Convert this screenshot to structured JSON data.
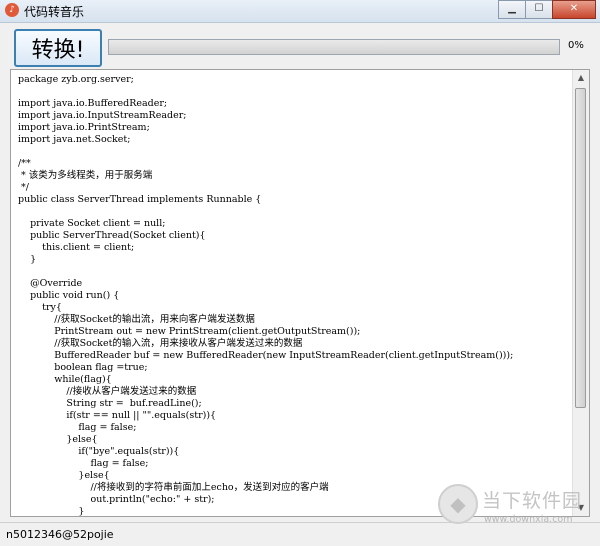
{
  "window": {
    "title": "代码转音乐"
  },
  "toolbar": {
    "convert_label": "转换!",
    "progress_fraction": 0,
    "progress_text": "0%"
  },
  "editor": {
    "code": "package zyb.org.server;\n\nimport java.io.BufferedReader;\nimport java.io.InputStreamReader;\nimport java.io.PrintStream;\nimport java.net.Socket;\n\n/**\n * 该类为多线程类，用于服务端\n */\npublic class ServerThread implements Runnable {\n\n    private Socket client = null;\n    public ServerThread(Socket client){\n        this.client = client;\n    }\n\n    @Override\n    public void run() {\n        try{\n            //获取Socket的输出流，用来向客户端发送数据\n            PrintStream out = new PrintStream(client.getOutputStream());\n            //获取Socket的输入流，用来接收从客户端发送过来的数据\n            BufferedReader buf = new BufferedReader(new InputStreamReader(client.getInputStream()));\n            boolean flag =true;\n            while(flag){\n                //接收从客户端发送过来的数据\n                String str =  buf.readLine();\n                if(str == null || \"\".equals(str)){\n                    flag = false;\n                }else{\n                    if(\"bye\".equals(str)){\n                        flag = false;\n                    }else{\n                        //将接收到的字符串前面加上echo，发送到对应的客户端\n                        out.println(\"echo:\" + str);\n                    }"
  },
  "status": {
    "text": "n5012346@52pojie"
  },
  "watermark": {
    "name": "当下软件园",
    "url": "www.downxia.com"
  },
  "icons": {
    "app": "music-note-icon",
    "minimize": "minimize-icon",
    "maximize": "maximize-icon",
    "close": "close-icon",
    "scroll_up": "chevron-up-icon",
    "scroll_down": "chevron-down-icon",
    "watermark_logo": "shield-logo-icon"
  }
}
